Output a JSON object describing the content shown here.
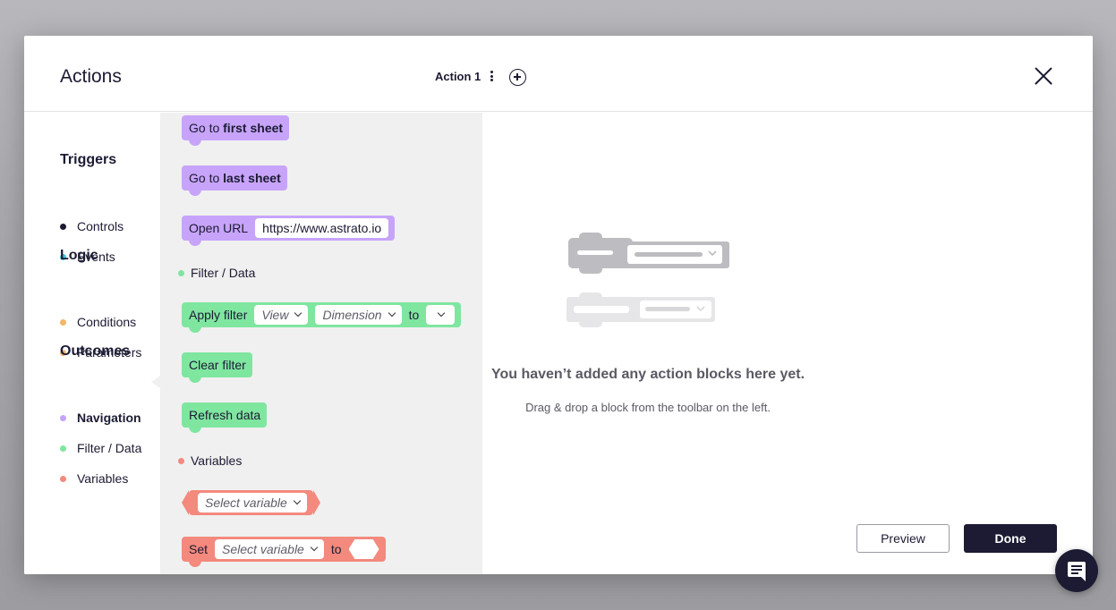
{
  "header": {
    "title": "Actions",
    "action_tab": "Action 1"
  },
  "sidebar": {
    "groups": [
      {
        "heading": "Triggers",
        "items": [
          {
            "label": "Controls",
            "color": "#1c1b33"
          },
          {
            "label": "Events",
            "color": "#3dc7e0"
          }
        ]
      },
      {
        "heading": "Logic",
        "items": [
          {
            "label": "Conditions",
            "color": "#f2b56b"
          },
          {
            "label": "Parameters",
            "color": "#f2b56b"
          }
        ]
      },
      {
        "heading": "Outcomes",
        "items": [
          {
            "label": "Navigation",
            "color": "#c7a4fa",
            "active": true
          },
          {
            "label": "Filter / Data",
            "color": "#7fe6a0"
          },
          {
            "label": "Variables",
            "color": "#f4897d"
          }
        ]
      }
    ]
  },
  "toolbox": {
    "go_first": {
      "prefix": "Go to ",
      "bold": "first sheet"
    },
    "go_last": {
      "prefix": "Go to ",
      "bold": "last sheet"
    },
    "open_url": {
      "label": "Open URL",
      "value": "https://www.astrato.io"
    },
    "section_filter": "Filter / Data",
    "apply_filter": {
      "label": "Apply filter",
      "view": "View",
      "dimension": "Dimension",
      "to": "to"
    },
    "clear_filter": "Clear filter",
    "refresh_data": "Refresh data",
    "section_variables": "Variables",
    "select_variable": "Select variable",
    "set_variable": {
      "label": "Set",
      "placeholder": "Select variable",
      "to": "to"
    }
  },
  "canvas": {
    "empty_title": "You haven’t added any action blocks here yet.",
    "empty_sub": "Drag & drop a block from the toolbar on the left.",
    "preview_label": "Preview",
    "done_label": "Done"
  },
  "colors": {
    "navigation": "#c7a4fa",
    "filter": "#7fe6a0",
    "variables": "#f4897d",
    "primary": "#1c1b33"
  }
}
